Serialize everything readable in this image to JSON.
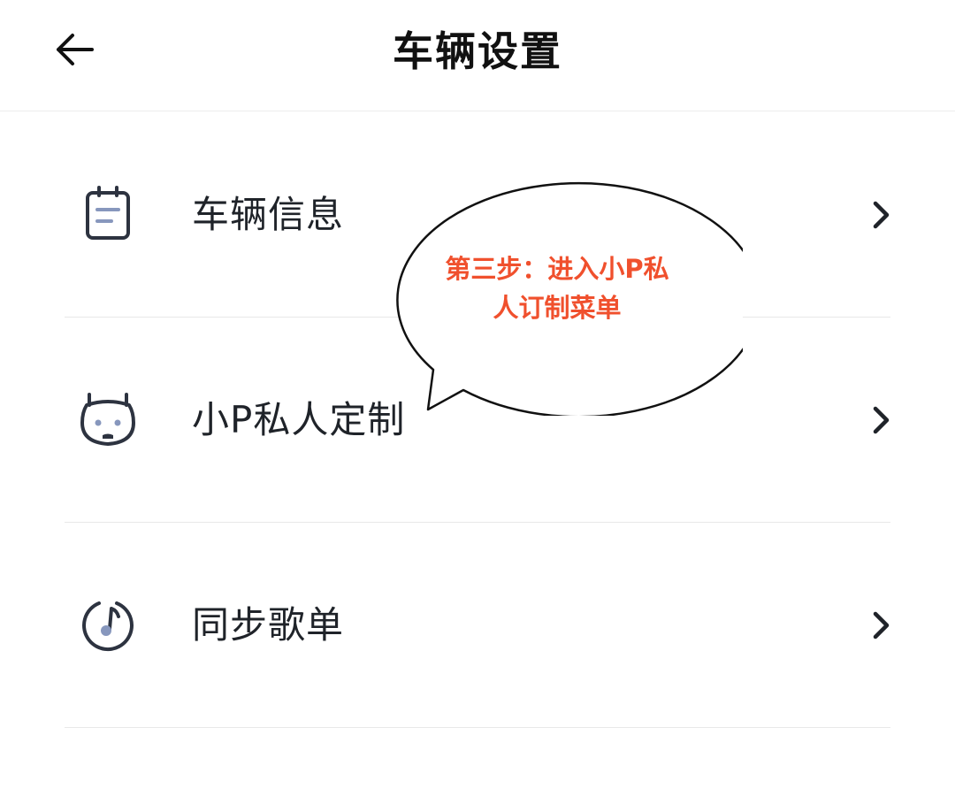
{
  "header": {
    "title": "车辆设置",
    "back_icon": "arrow-left-icon"
  },
  "menu": {
    "items": [
      {
        "label": "车辆信息",
        "icon": "clipboard-icon"
      },
      {
        "label": "小P私人定制",
        "icon": "robot-face-icon"
      },
      {
        "label": "同步歌单",
        "icon": "music-note-icon"
      }
    ],
    "chevron_icon": "chevron-right-icon"
  },
  "callout": {
    "line1": "第三步：进入小P私",
    "line2": "人订制菜单",
    "text_color": "#f0502d"
  },
  "colors": {
    "icon_color": "#2d3340",
    "icon_accent": "#8797bd",
    "divider": "#e8e8e8"
  }
}
